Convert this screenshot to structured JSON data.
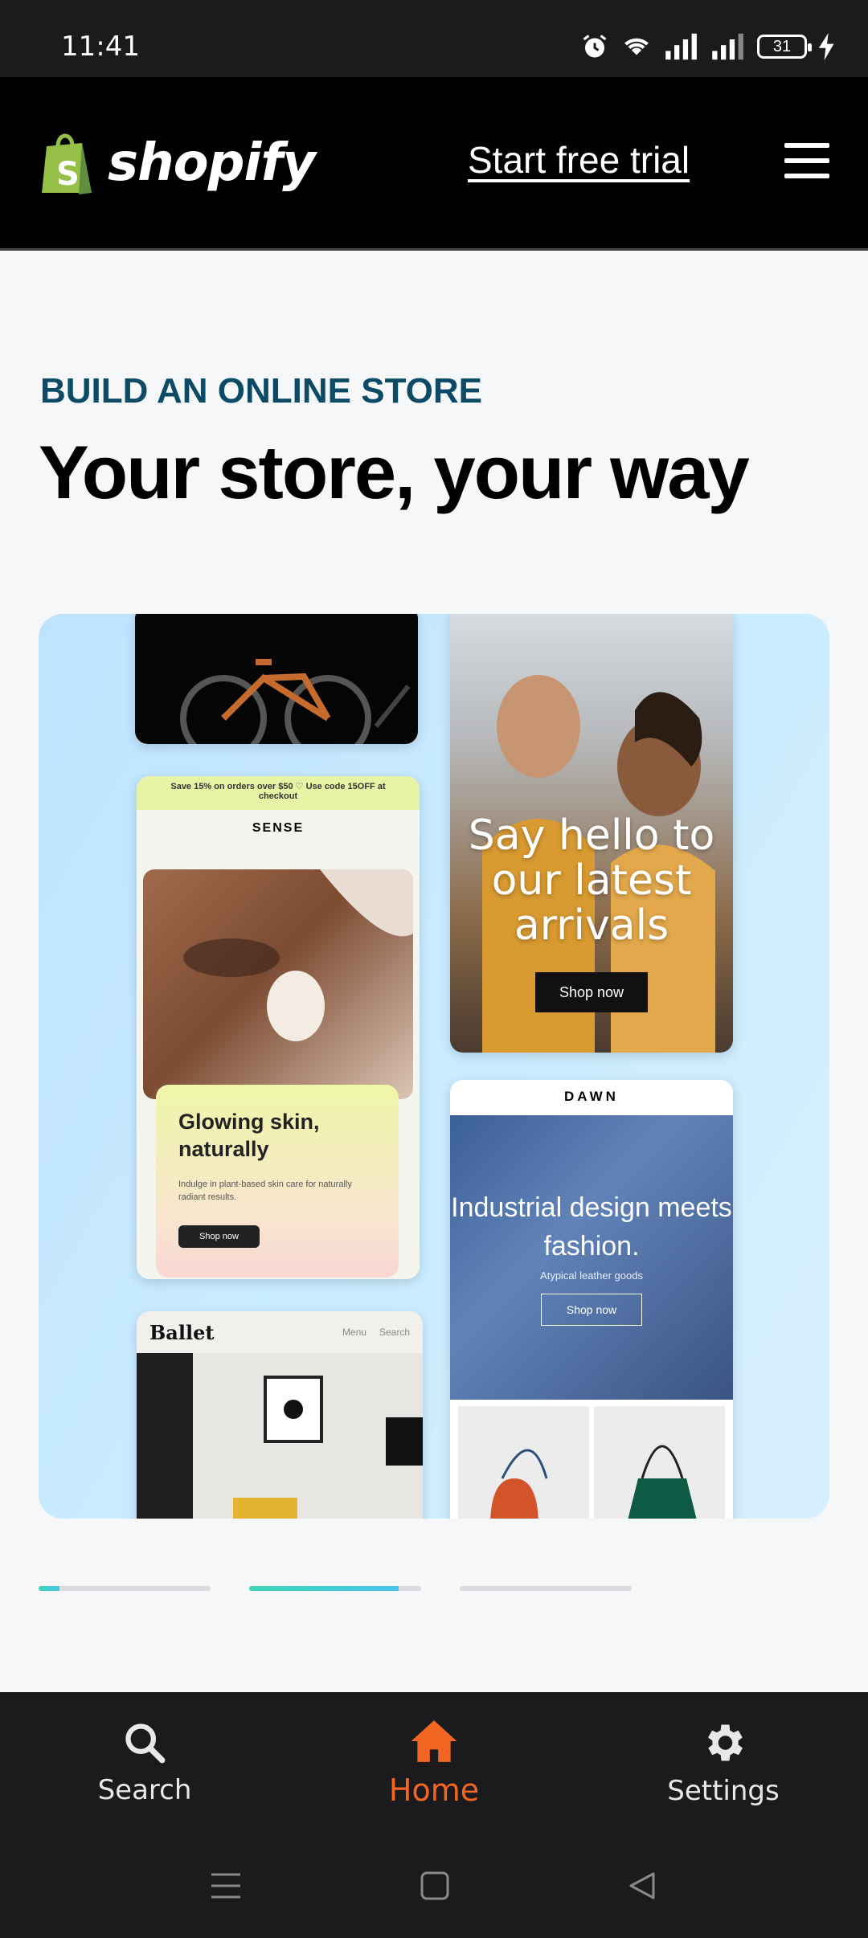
{
  "status_bar": {
    "time": "11:41",
    "battery": "31"
  },
  "header": {
    "brand": "shopify",
    "cta": "Start free trial"
  },
  "hero": {
    "eyebrow": "BUILD AN ONLINE STORE",
    "headline": "Your store, your way"
  },
  "cards": {
    "sense": {
      "banner": "Save 15% on orders over $50 ♡ Use code 15OFF at checkout",
      "brand": "SENSE",
      "title": "Glowing skin, naturally",
      "subtitle": "Indulge in plant-based skin care for naturally radiant results.",
      "button": "Shop now"
    },
    "ballet": {
      "brand": "Ballet",
      "menu": "Menu",
      "search": "Search"
    },
    "fashion": {
      "headline": "Say hello to our latest arrivals",
      "button": "Shop now"
    },
    "dawn": {
      "brand": "DAWN",
      "headline": "Industrial design meets fashion.",
      "subtitle": "Atypical leather goods",
      "button": "Shop now"
    }
  },
  "carousel": {
    "progress": [
      0.12,
      0.87,
      0.0
    ]
  },
  "bottom_nav": [
    {
      "label": "Search",
      "icon": "search-icon",
      "active": false
    },
    {
      "label": "Home",
      "icon": "home-icon",
      "active": true
    },
    {
      "label": "Settings",
      "icon": "gear-icon",
      "active": false
    }
  ],
  "colors": {
    "accent": "#f26522",
    "eyebrow": "#0c4a66",
    "shopify_green": "#95bf47"
  }
}
